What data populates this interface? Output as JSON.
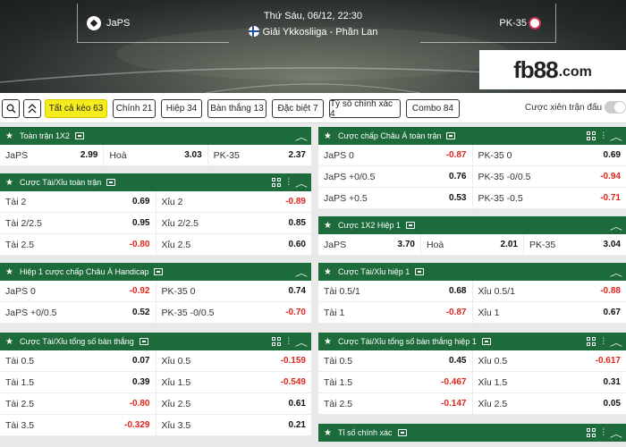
{
  "header": {
    "home_team": "JaPS",
    "away_team": "PK-35",
    "datetime": "Thứ Sáu, 06/12, 22:30",
    "league": "Giải Ykkosliiga - Phần Lan",
    "logo_main": "fb88",
    "logo_suffix": ".com"
  },
  "filters": {
    "tabs": [
      {
        "label": "Tất cả kèo 63",
        "active": true
      },
      {
        "label": "Chính 21"
      },
      {
        "label": "Hiệp 34"
      },
      {
        "label": "Bàn thắng 13"
      },
      {
        "label": "Đặc biệt 7"
      },
      {
        "label": "Tỷ số chính xác 4"
      },
      {
        "label": "Combo 84"
      }
    ],
    "combo_label": "Cược xiên trận đấu",
    "search_icon": "search-icon",
    "collapse_icon": "double-chevron-up-icon"
  },
  "panels": {
    "p1": {
      "title": "Toàn trận 1X2",
      "rows": [
        [
          [
            "JaPS",
            "2.99"
          ],
          [
            "Hoà",
            "3.03"
          ],
          [
            "PK-35",
            "2.37"
          ]
        ]
      ]
    },
    "p2": {
      "title": "Cược Tài/Xỉu toàn trận",
      "rows": [
        [
          [
            "Tài 2",
            "0.69"
          ],
          [
            "Xỉu 2",
            "-0.89"
          ]
        ],
        [
          [
            "Tài 2/2.5",
            "0.95"
          ],
          [
            "Xỉu 2/2.5",
            "0.85"
          ]
        ],
        [
          [
            "Tài 2.5",
            "-0.80"
          ],
          [
            "Xỉu 2.5",
            "0.60"
          ]
        ]
      ]
    },
    "p3": {
      "title": "Hiệp 1 cược chấp Châu Á Handicap",
      "rows": [
        [
          [
            "JaPS 0",
            "-0.92"
          ],
          [
            "PK-35 0",
            "0.74"
          ]
        ],
        [
          [
            "JaPS +0/0.5",
            "0.52"
          ],
          [
            "PK-35 -0/0.5",
            "-0.70"
          ]
        ]
      ]
    },
    "p4": {
      "title": "Cược Tài/Xỉu tổng số bàn thắng",
      "rows": [
        [
          [
            "Tài 0.5",
            "0.07"
          ],
          [
            "Xỉu 0.5",
            "-0.159"
          ]
        ],
        [
          [
            "Tài 1.5",
            "0.39"
          ],
          [
            "Xỉu 1.5",
            "-0.549"
          ]
        ],
        [
          [
            "Tài 2.5",
            "-0.80"
          ],
          [
            "Xỉu 2.5",
            "0.61"
          ]
        ],
        [
          [
            "Tài 3.5",
            "-0.329"
          ],
          [
            "Xỉu 3.5",
            "0.21"
          ]
        ]
      ]
    },
    "p5": {
      "title": "Cược chấp Châu Á toàn trận",
      "rows": [
        [
          [
            "JaPS 0",
            "-0.87"
          ],
          [
            "PK-35 0",
            "0.69"
          ]
        ],
        [
          [
            "JaPS +0/0.5",
            "0.76"
          ],
          [
            "PK-35 -0/0.5",
            "-0.94"
          ]
        ],
        [
          [
            "JaPS +0.5",
            "0.53"
          ],
          [
            "PK-35 -0.5",
            "-0.71"
          ]
        ]
      ]
    },
    "p6": {
      "title": "Cược 1X2 Hiệp 1",
      "rows": [
        [
          [
            "JaPS",
            "3.70"
          ],
          [
            "Hoà",
            "2.01"
          ],
          [
            "PK-35",
            "3.04"
          ]
        ]
      ]
    },
    "p7": {
      "title": "Cược Tài/Xỉu hiệp 1",
      "rows": [
        [
          [
            "Tài 0.5/1",
            "0.68"
          ],
          [
            "Xỉu 0.5/1",
            "-0.88"
          ]
        ],
        [
          [
            "Tài 1",
            "-0.87"
          ],
          [
            "Xỉu 1",
            "0.67"
          ]
        ]
      ]
    },
    "p8": {
      "title": "Cược Tài/Xỉu tổng số bàn thắng hiệp 1",
      "rows": [
        [
          [
            "Tài 0.5",
            "0.45"
          ],
          [
            "Xỉu 0.5",
            "-0.617"
          ]
        ],
        [
          [
            "Tài 1.5",
            "-0.467"
          ],
          [
            "Xỉu 1.5",
            "0.31"
          ]
        ],
        [
          [
            "Tài 2.5",
            "-0.147"
          ],
          [
            "Xỉu 2.5",
            "0.05"
          ]
        ]
      ]
    },
    "p9": {
      "title": "Tỉ số chính xác",
      "rows": []
    }
  }
}
